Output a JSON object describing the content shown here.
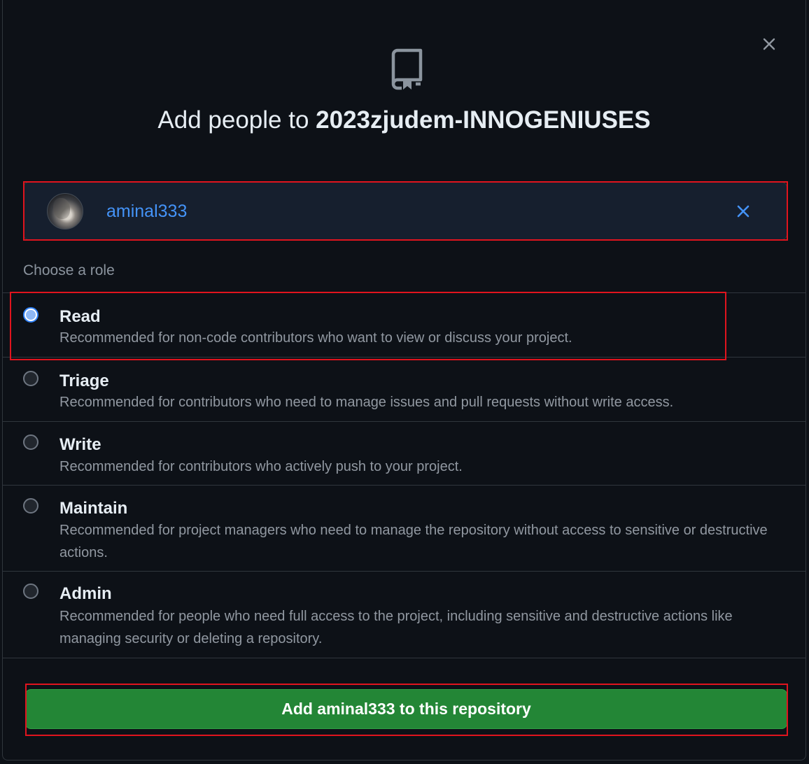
{
  "dialog": {
    "title_prefix": "Add people to ",
    "repo_name": "2023zjudem-INNOGENIUSES",
    "close_icon": "close-icon",
    "repo_icon": "repo-icon"
  },
  "selected_user": {
    "username": "aminal333",
    "avatar_icon": "avatar",
    "remove_icon": "close-icon"
  },
  "role_section": {
    "label": "Choose a role",
    "selected": "Read",
    "roles": [
      {
        "name": "Read",
        "description": "Recommended for non-code contributors who want to view or discuss your project."
      },
      {
        "name": "Triage",
        "description": "Recommended for contributors who need to manage issues and pull requests without write access."
      },
      {
        "name": "Write",
        "description": "Recommended for contributors who actively push to your project."
      },
      {
        "name": "Maintain",
        "description": "Recommended for project managers who need to manage the repository without access to sensitive or destructive actions."
      },
      {
        "name": "Admin",
        "description": "Recommended for people who need full access to the project, including sensitive and destructive actions like managing security or deleting a repository."
      }
    ]
  },
  "submit": {
    "label": "Add aminal333 to this repository"
  },
  "colors": {
    "background": "#0d1117",
    "accent_blue": "#4493f8",
    "button_green": "#238636",
    "highlight_red": "#e0141e"
  }
}
